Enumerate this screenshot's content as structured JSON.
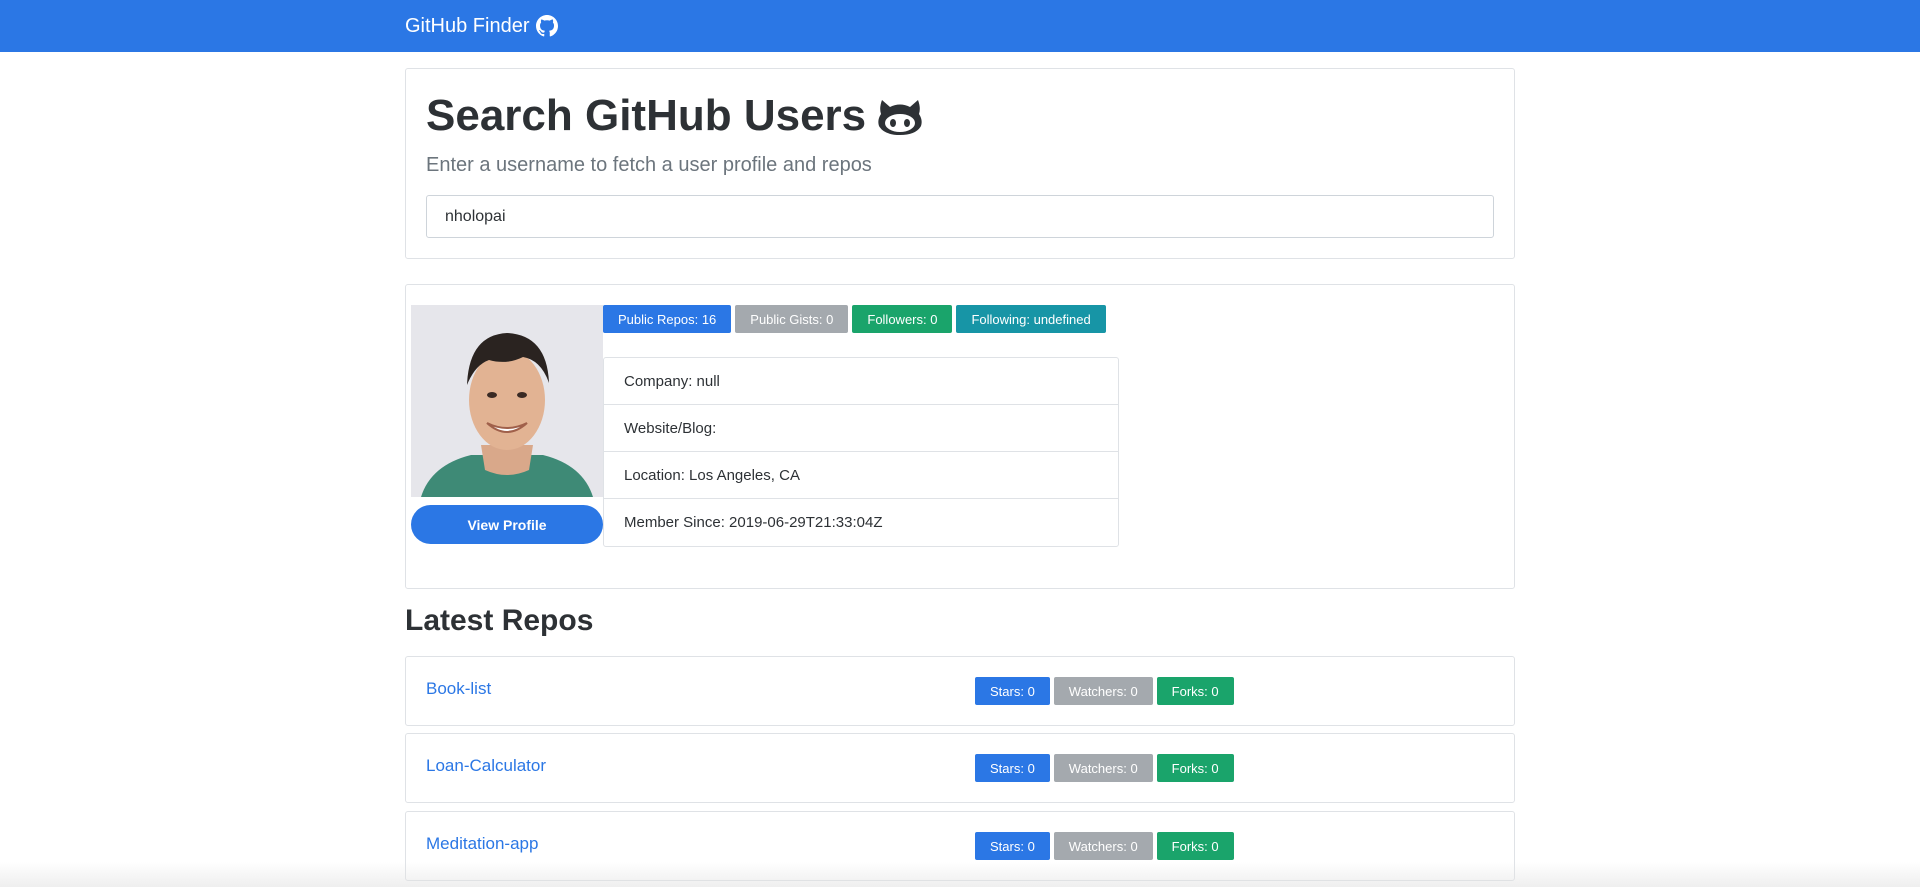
{
  "navbar": {
    "brand": "GitHub Finder",
    "brand_icon": "github-icon",
    "color": "#2b77e5"
  },
  "search": {
    "heading": "Search GitHub Users",
    "heading_icon": "octocat-icon",
    "lead": "Enter a username to fetch a user profile and repos",
    "input_value": "nholopai"
  },
  "profile": {
    "avatar_alt": "avatar",
    "view_profile_label": "View Profile",
    "badges": {
      "public_repos": "Public Repos: 16",
      "public_gists": "Public Gists: 0",
      "followers": "Followers: 0",
      "following": "Following: undefined"
    },
    "info": {
      "company": "Company: null",
      "website": "Website/Blog:",
      "location": "Location: Los Angeles, CA",
      "member_since": "Member Since: 2019-06-29T21:33:04Z"
    }
  },
  "repos": {
    "title": "Latest Repos",
    "items": [
      {
        "name": "Book-list",
        "stars": "Stars: 0",
        "watchers": "Watchers: 0",
        "forks": "Forks: 0"
      },
      {
        "name": "Loan-Calculator",
        "stars": "Stars: 0",
        "watchers": "Watchers: 0",
        "forks": "Forks: 0"
      },
      {
        "name": "Meditation-app",
        "stars": "Stars: 0",
        "watchers": "Watchers: 0",
        "forks": "Forks: 0"
      }
    ]
  }
}
